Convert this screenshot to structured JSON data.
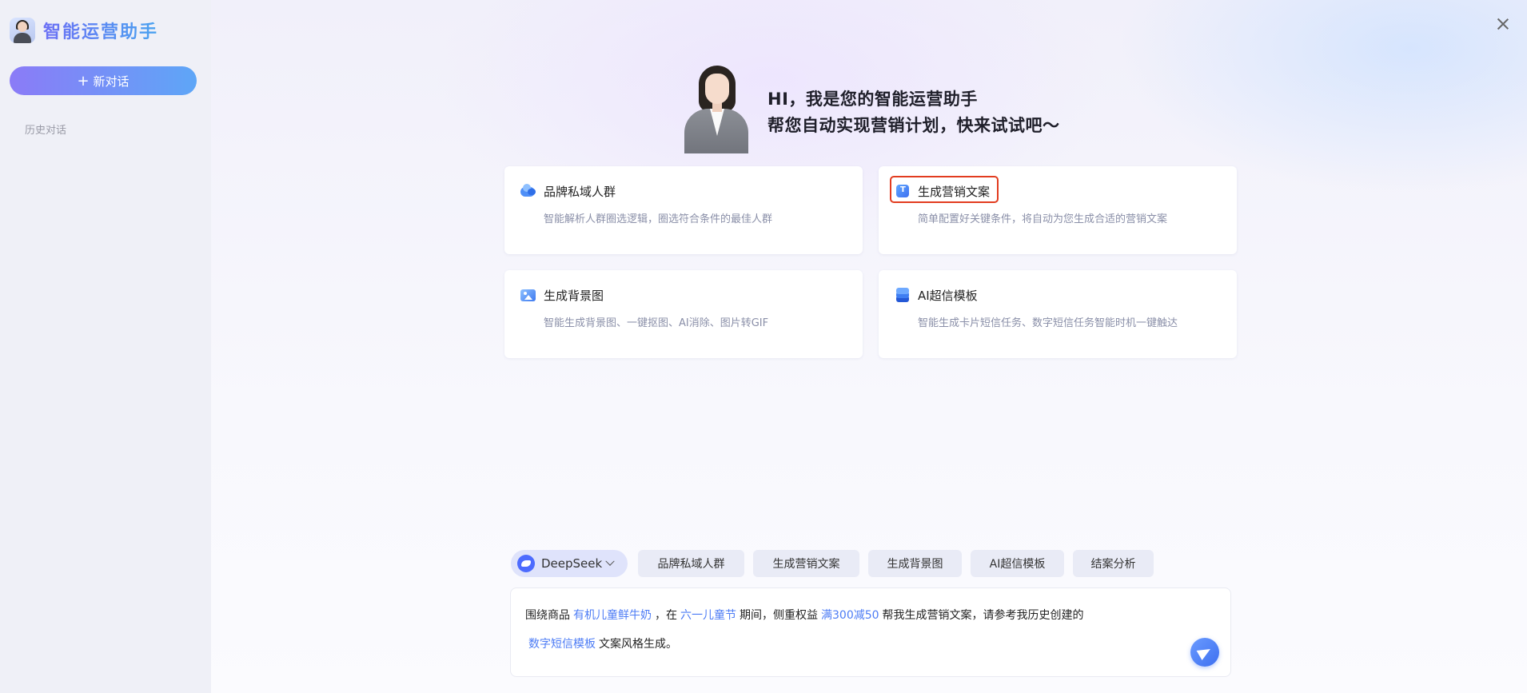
{
  "sidebar": {
    "brand_title": "智能运营助手",
    "new_chat_label": "新对话",
    "history_label": "历史对话"
  },
  "hero": {
    "line1": "HI，我是您的智能运营助手",
    "line2": "帮您自动实现营销计划，快来试试吧～"
  },
  "cards": [
    {
      "icon": "cloud-icon",
      "title": "品牌私域人群",
      "desc": "智能解析人群圈选逻辑，圈选符合条件的最佳人群"
    },
    {
      "icon": "document-icon",
      "title": "生成营销文案",
      "desc": "简单配置好关键条件，将自动为您生成合适的营销文案",
      "highlighted": true
    },
    {
      "icon": "image-icon",
      "title": "生成背景图",
      "desc": "智能生成背景图、一键抠图、AI消除、图片转GIF"
    },
    {
      "icon": "layers-icon",
      "title": "AI超信模板",
      "desc": "智能生成卡片短信任务、数字短信任务智能时机一键触达"
    }
  ],
  "model_selector": {
    "label": "DeepSeek",
    "icon": "deepseek-icon"
  },
  "quick_tags": [
    "品牌私域人群",
    "生成营销文案",
    "生成背景图",
    "AI超信模板",
    "结案分析"
  ],
  "prompt": {
    "t1": "围绕商品",
    "v1": "有机儿童鲜牛奶",
    "t2": "，在",
    "v2": "六一儿童节",
    "t3": "期间，侧重权益",
    "v3": "满300减50",
    "t4": "帮我生成营销文案，请参考我历史创建的",
    "v4": "数字短信模板",
    "t5": "文案风格生成。"
  },
  "colors": {
    "accent": "#4d7cf5",
    "highlight_border": "#e23c1f",
    "new_chat_gradient_start": "#8b7bf7",
    "new_chat_gradient_end": "#5ea6f7"
  }
}
